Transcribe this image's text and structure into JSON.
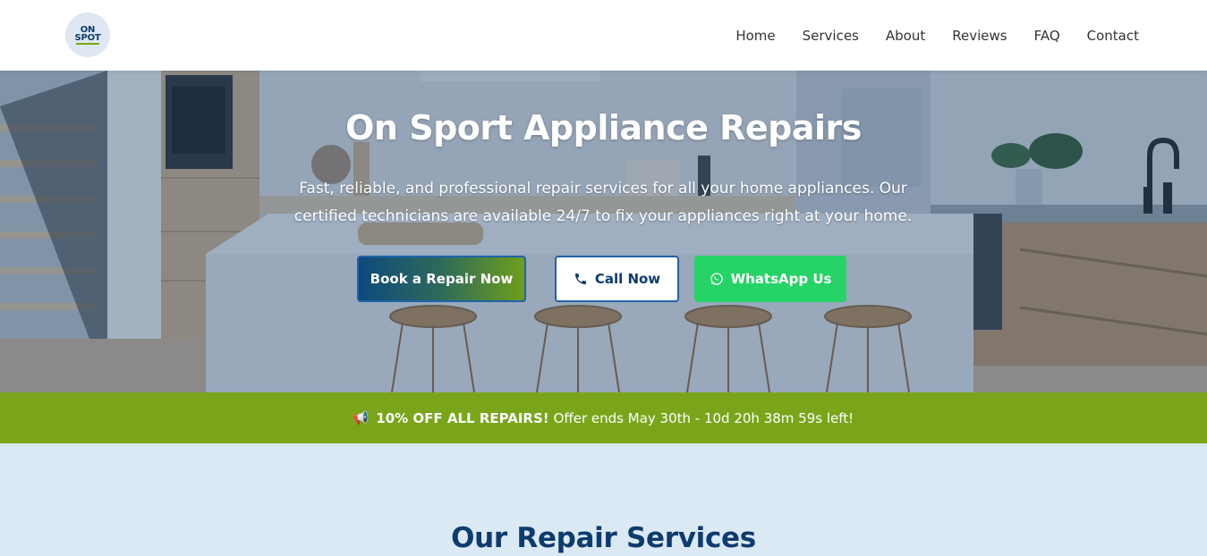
{
  "brand": {
    "logo_line1": "ON",
    "logo_line2": "SPOT",
    "logo_alt": "On Spot logo"
  },
  "nav": {
    "items": [
      {
        "label": "Home"
      },
      {
        "label": "Services"
      },
      {
        "label": "About"
      },
      {
        "label": "Reviews"
      },
      {
        "label": "FAQ"
      },
      {
        "label": "Contact"
      }
    ]
  },
  "hero": {
    "title": "On Sport Appliance Repairs",
    "subtitle": "Fast, reliable, and professional repair services for all your home appliances. Our certified technicians are available 24/7 to fix your appliances right at your home.",
    "buttons": {
      "book": "Book a Repair Now",
      "call": "Call Now",
      "whatsapp": "WhatsApp Us"
    }
  },
  "promo": {
    "icon": "megaphone-icon",
    "highlight": "10% OFF ALL REPAIRS!",
    "text": "Offer ends May 30th - 10d 20h 38m 59s left!"
  },
  "services": {
    "title": "Our Repair Services"
  },
  "colors": {
    "primary": "#0d3b6e",
    "accent_green": "#7aa51a",
    "whatsapp": "#25d366",
    "section_bg": "#dbe9f5"
  }
}
